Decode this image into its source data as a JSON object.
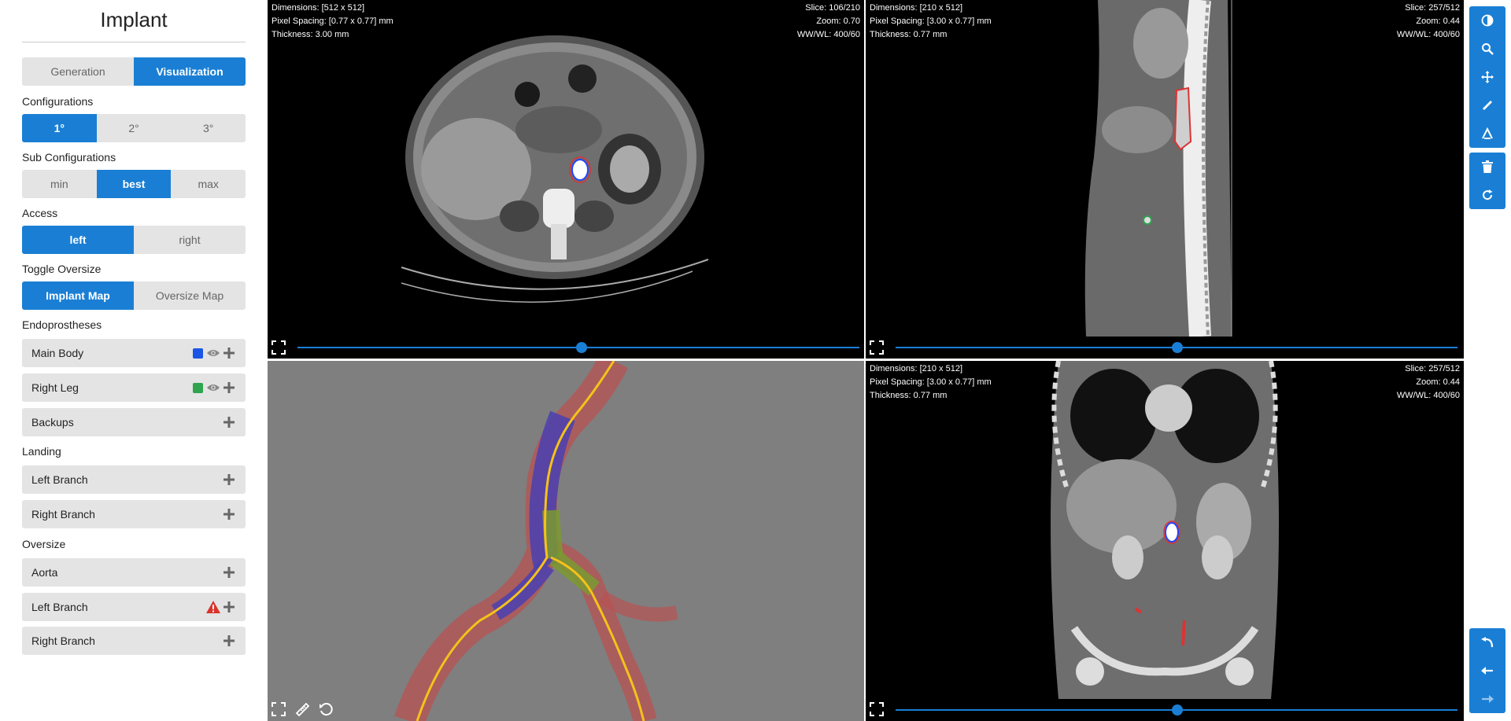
{
  "app": {
    "title": "Implant"
  },
  "tabs": [
    {
      "label": "Generation",
      "active": false
    },
    {
      "label": "Visualization",
      "active": true
    }
  ],
  "configurations": {
    "label": "Configurations",
    "options": [
      {
        "label": "1°",
        "active": true
      },
      {
        "label": "2°",
        "active": false
      },
      {
        "label": "3°",
        "active": false
      }
    ]
  },
  "sub_configurations": {
    "label": "Sub Configurations",
    "options": [
      {
        "label": "min",
        "active": false
      },
      {
        "label": "best",
        "active": true
      },
      {
        "label": "max",
        "active": false
      }
    ]
  },
  "access": {
    "label": "Access",
    "options": [
      {
        "label": "left",
        "active": true
      },
      {
        "label": "right",
        "active": false
      }
    ]
  },
  "toggle_oversize": {
    "label": "Toggle Oversize",
    "options": [
      {
        "label": "Implant Map",
        "active": true
      },
      {
        "label": "Oversize Map",
        "active": false
      }
    ]
  },
  "endoprostheses": {
    "label": "Endoprostheses",
    "items": [
      {
        "label": "Main Body",
        "color": "#1a56e6",
        "visible": true
      },
      {
        "label": "Right Leg",
        "color": "#2ea44f",
        "visible": true
      },
      {
        "label": "Backups"
      }
    ]
  },
  "landing": {
    "label": "Landing",
    "items": [
      {
        "label": "Left Branch"
      },
      {
        "label": "Right Branch"
      }
    ]
  },
  "oversize": {
    "label": "Oversize",
    "items": [
      {
        "label": "Aorta"
      },
      {
        "label": "Left Branch",
        "warning": true
      },
      {
        "label": "Right Branch"
      }
    ]
  },
  "viewports": {
    "axial": {
      "dimensions": "Dimensions: [512 x 512]",
      "pixel_spacing": "Pixel Spacing: [0.77 x 0.77] mm",
      "thickness": "Thickness: 3.00 mm",
      "slice": "Slice: 106/210",
      "zoom": "Zoom: 0.70",
      "wwwl": "WW/WL: 400/60",
      "slider_pos": 0.505
    },
    "sagittal": {
      "dimensions": "Dimensions: [210 x 512]",
      "pixel_spacing": "Pixel Spacing: [3.00 x 0.77] mm",
      "thickness": "Thickness: 0.77 mm",
      "slice": "Slice: 257/512",
      "zoom": "Zoom: 0.44",
      "wwwl": "WW/WL: 400/60",
      "slider_pos": 0.501
    },
    "coronal": {
      "dimensions": "Dimensions: [210 x 512]",
      "pixel_spacing": "Pixel Spacing: [3.00 x 0.77] mm",
      "thickness": "Thickness: 0.77 mm",
      "slice": "Slice: 257/512",
      "zoom": "Zoom: 0.44",
      "wwwl": "WW/WL: 400/60",
      "slider_pos": 0.501
    }
  },
  "toolbar": {
    "top": [
      "contrast-icon",
      "zoom-icon",
      "pan-icon",
      "ruler-icon",
      "angle-icon"
    ],
    "middle": [
      "trash-icon",
      "reset-icon"
    ],
    "bottom": [
      "undo-icon",
      "back-arrow-icon",
      "forward-arrow-icon"
    ]
  },
  "colors": {
    "accent": "#1a7fd4",
    "panel": "#e4e4e4",
    "warning": "#d9342b"
  }
}
